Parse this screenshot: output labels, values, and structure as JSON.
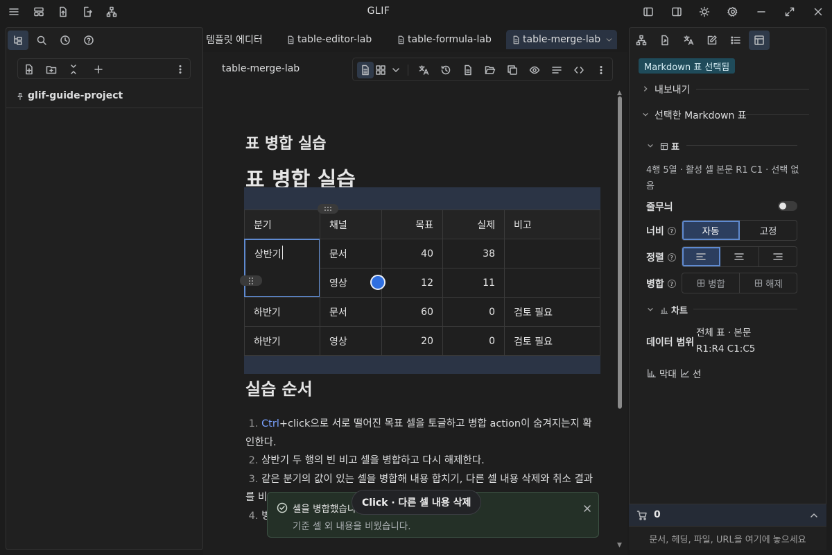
{
  "app": {
    "title": "GLIF"
  },
  "left": {
    "vault_name": "glif-guide-project"
  },
  "tabs": [
    {
      "label": "템플릿 에디터"
    },
    {
      "label": "table-editor-lab"
    },
    {
      "label": "table-formula-lab"
    },
    {
      "label": "table-merge-lab",
      "active": true
    }
  ],
  "editor": {
    "note_title": "table-merge-lab",
    "h3": "표 병합 실습",
    "h1": "표 병합 실습",
    "h2": "실습 순서"
  },
  "table": {
    "headers": [
      "분기",
      "채널",
      "목표",
      "실제",
      "비고"
    ],
    "rows": [
      [
        "상반기",
        "문서",
        "40",
        "38",
        ""
      ],
      [
        "",
        "영상",
        "12",
        "11",
        ""
      ],
      [
        "하반기",
        "문서",
        "60",
        "0",
        "검토 필요"
      ],
      [
        "하반기",
        "영상",
        "20",
        "0",
        "검토 필요"
      ]
    ]
  },
  "steps": {
    "s1_num": "1.",
    "s1_kw": "Ctrl",
    "s1_text": "+click으로 서로 떨어진 목표 셀을 토글하고 병합 action이 숨겨지는지 확인한다.",
    "s2_num": "2.",
    "s2_text": "상반기 두 행의 빈 비고 셀을 병합하고 다시 해제한다.",
    "s3_num": "3.",
    "s3_text": "같은 분기의 값이 있는 셀을 병합해 내용 합치기, 다른 셀 내용 삭제와 취소 결과를 비",
    "s4_num": "4.",
    "s4_text": "병"
  },
  "toast": {
    "title": "셀을 병합했습니",
    "message": "기준 셀 외 내용을 비웠습니다.",
    "pill": "Click · 다른 셀 내용 삭제"
  },
  "right": {
    "badge": "Markdown 표 선택됨",
    "export": "내보내기",
    "selected_table": "선택한 Markdown 표",
    "table_section": "표",
    "table_info": "4행 5열 · 활성 셀 본문 R1 C1 · 선택 없음",
    "stripes_label": "줄무늬",
    "width_label": "너비",
    "width_options": [
      "자동",
      "고정"
    ],
    "align_label": "정렬",
    "merge_label": "병합",
    "merge_btn": "병합",
    "unmerge_btn": "해제",
    "chart_section": "차트",
    "data_range_label": "데이터 범위",
    "data_range_value": "전체 표 · 본문 R1:R4 C1:C5",
    "bar_label": "막대",
    "line_label": "선",
    "help_glyph": "?"
  },
  "cart": {
    "count": "0"
  },
  "drop_zone": {
    "text": "문서, 헤딩, 파일, URL을 여기에 놓으세요"
  }
}
